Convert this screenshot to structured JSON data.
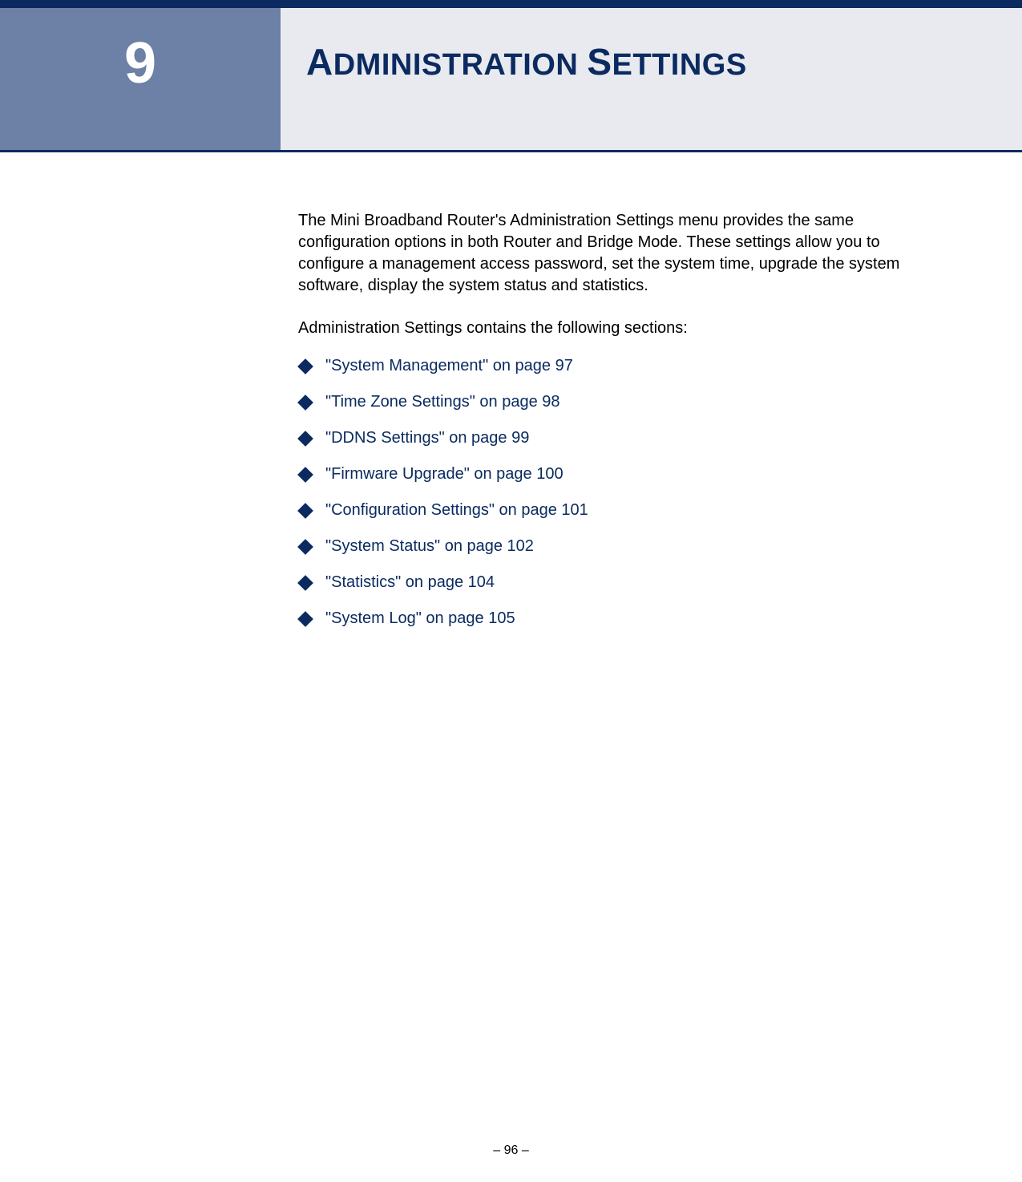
{
  "chapter": {
    "number": "9",
    "title_parts": {
      "a1": "A",
      "a2": "DMINISTRATION",
      "s1": "S",
      "s2": "ETTINGS"
    }
  },
  "intro": "The Mini Broadband Router's Administration Settings menu provides the same configuration options in both Router and Bridge Mode. These settings allow you to configure a management access password, set the system time, upgrade the system software, display the system status and statistics.",
  "sections_intro": "Administration Settings contains the following sections:",
  "toc": [
    {
      "label": "\"System Management\" on page 97"
    },
    {
      "label": "\"Time Zone Settings\" on page 98"
    },
    {
      "label": "\"DDNS Settings\" on page 99"
    },
    {
      "label": "\"Firmware Upgrade\" on page 100"
    },
    {
      "label": "\"Configuration Settings\" on page 101"
    },
    {
      "label": "\"System Status\" on page 102"
    },
    {
      "label": "\"Statistics\" on page 104"
    },
    {
      "label": "\"System Log\" on page 105"
    }
  ],
  "page_number": "–  96  –"
}
